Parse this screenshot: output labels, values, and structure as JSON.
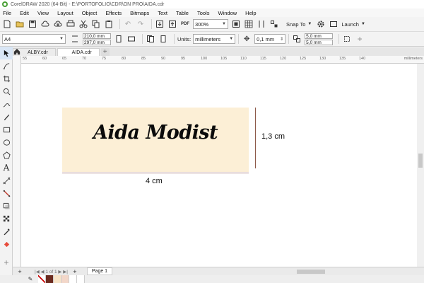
{
  "window": {
    "title": "CorelDRAW 2020 (64-Bit) - E:\\PORTOFOLIO\\CDR\\ON PRO\\AIDA.cdr"
  },
  "menu": [
    "File",
    "Edit",
    "View",
    "Layout",
    "Object",
    "Effects",
    "Bitmaps",
    "Text",
    "Table",
    "Tools",
    "Window",
    "Help"
  ],
  "toolbar": {
    "zoom": "300%",
    "snap_to": "Snap To",
    "launch": "Launch",
    "pdf_label": "PDF"
  },
  "property_bar": {
    "page_size": "A4",
    "width": "210,0 mm",
    "height": "297,0 mm",
    "units_label": "Units:",
    "units": "millimeters",
    "nudge": "0,1 mm",
    "dup_x": "5,0 mm",
    "dup_y": "5,0 mm"
  },
  "tabs": [
    {
      "label": "ALBY.cdr",
      "active": false
    },
    {
      "label": "AIDA.cdr",
      "active": true
    }
  ],
  "ruler": {
    "unit": "millimeters",
    "ticks": [
      "55",
      "60",
      "65",
      "70",
      "75",
      "80",
      "85",
      "90",
      "95",
      "100",
      "105",
      "110",
      "115",
      "120",
      "125",
      "130",
      "135",
      "140"
    ]
  },
  "artwork": {
    "text": "Aida Modist",
    "fill_color": "#fcefd6",
    "width_label": "4 cm",
    "height_label": "1,3 cm"
  },
  "page_nav": {
    "counter": "1 of 1",
    "page_tab": "Page 1"
  },
  "palette": [
    "#ffffff",
    "#6b2a1e",
    "#f8e4c8",
    "#f3d7c9",
    "#ffffff",
    "#ffffff",
    "#ffffff"
  ]
}
